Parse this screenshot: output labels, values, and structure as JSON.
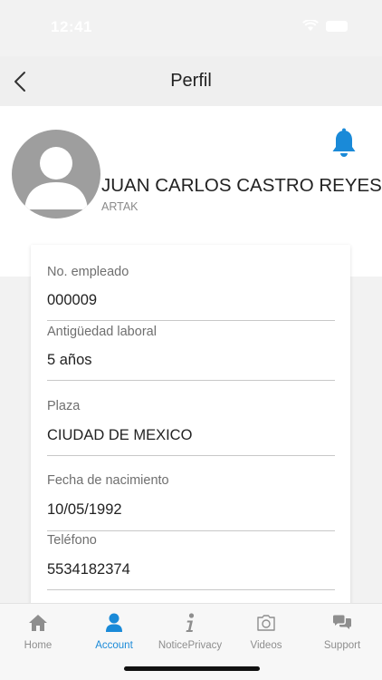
{
  "status_bar": {
    "time": "12:41"
  },
  "header": {
    "title": "Perfil",
    "back_icon": "chevron-left-icon"
  },
  "profile": {
    "name": "JUAN CARLOS CASTRO REYES",
    "company": "ARTAK",
    "notification_icon": "bell-icon"
  },
  "fields": [
    {
      "label": "No. empleado",
      "value": "000009"
    },
    {
      "label": "Antigüedad laboral",
      "value": "5 años"
    },
    {
      "label": "Plaza",
      "value": "CIUDAD DE MEXICO"
    },
    {
      "label": "Fecha de nacimiento",
      "value": "10/05/1992"
    },
    {
      "label": "Teléfono",
      "value": "5534182374"
    }
  ],
  "tabs": [
    {
      "label": "Home",
      "icon": "home-icon",
      "active": false
    },
    {
      "label": "Account",
      "icon": "person-icon",
      "active": true
    },
    {
      "label": "NoticePrivacy",
      "icon": "info-icon",
      "active": false
    },
    {
      "label": "Videos",
      "icon": "camera-icon",
      "active": false
    },
    {
      "label": "Support",
      "icon": "chat-icon",
      "active": false
    }
  ],
  "colors": {
    "accent": "#1a8ad8",
    "inactive": "#8e8e8e"
  }
}
